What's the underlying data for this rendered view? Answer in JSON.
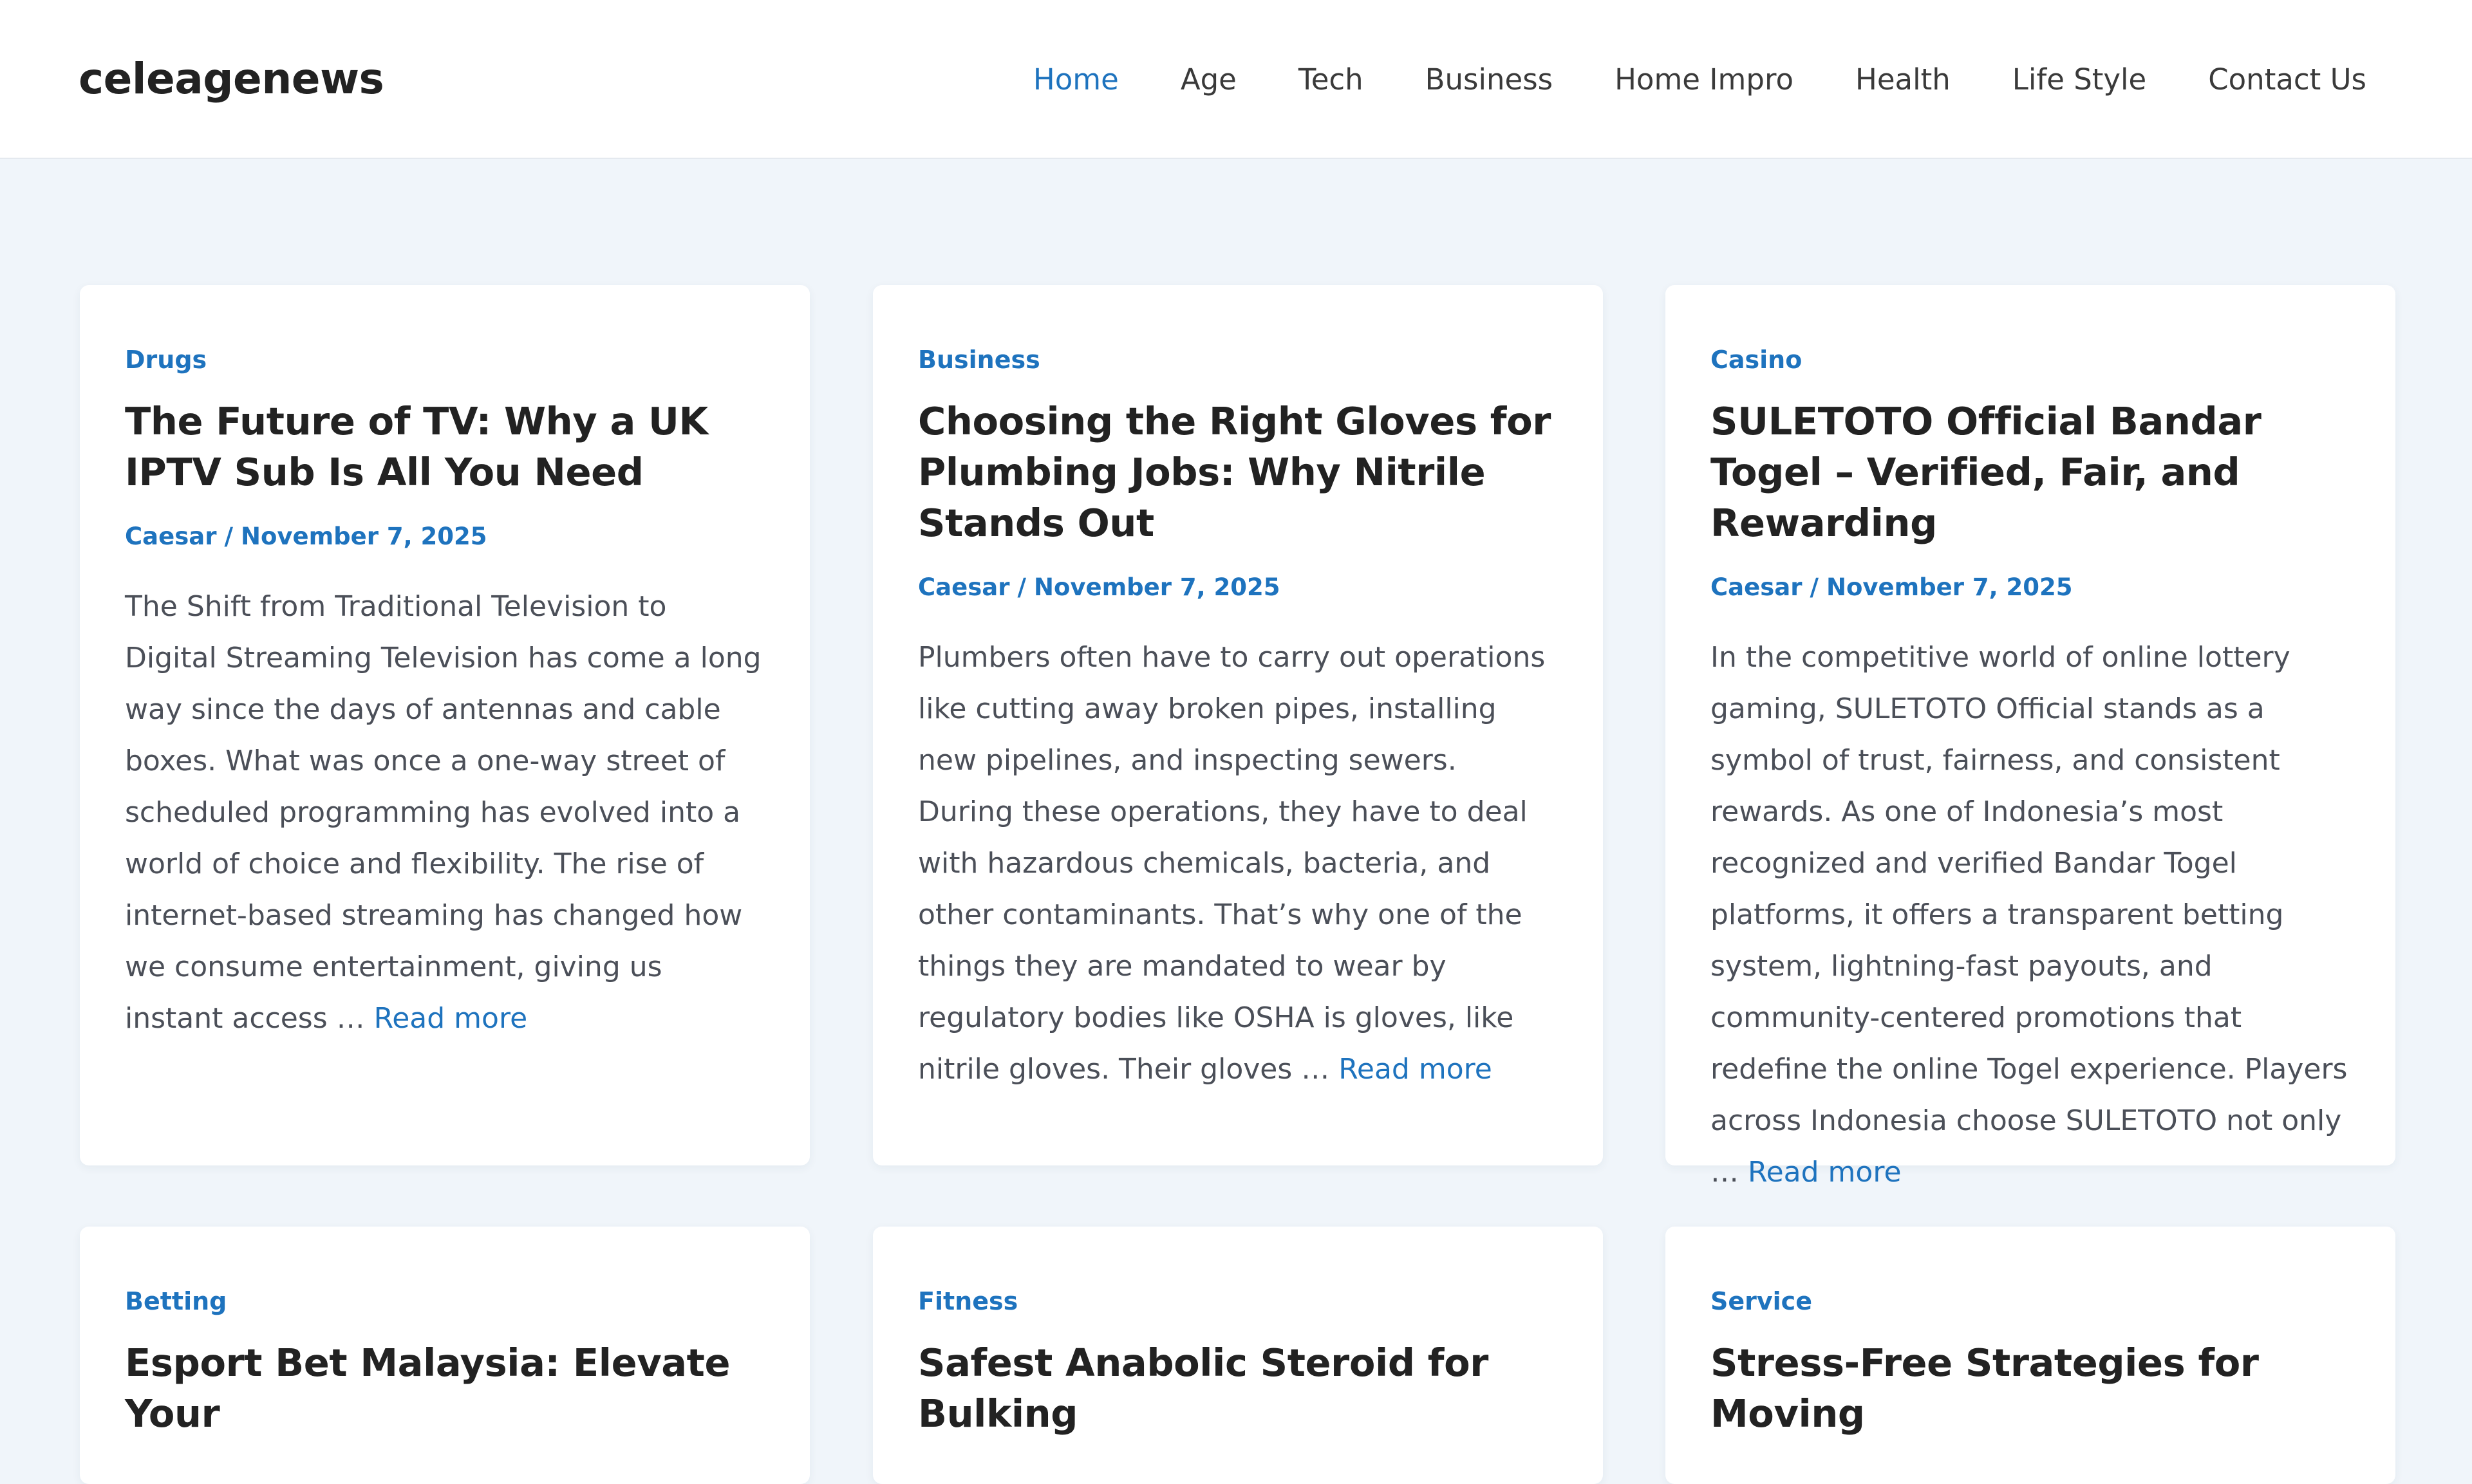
{
  "site": {
    "title": "celeagenews"
  },
  "nav": {
    "items": [
      {
        "label": "Home"
      },
      {
        "label": "Age"
      },
      {
        "label": "Tech"
      },
      {
        "label": "Business"
      },
      {
        "label": "Home Impro"
      },
      {
        "label": "Health"
      },
      {
        "label": "Life Style"
      },
      {
        "label": "Contact Us"
      }
    ],
    "active": "Home"
  },
  "colors": {
    "accent": "#1e73be",
    "background": "#f0f5fa",
    "card": "#ffffff"
  },
  "posts": [
    {
      "category": "Drugs",
      "title": "The Future of TV: Why a UK IPTV Sub Is All You Need",
      "author": "Caesar",
      "date": "November 7, 2025",
      "excerpt": "The Shift from Traditional Television to Digital Streaming Television has come a long way since the days of antennas and cable boxes. What was once a one-way street of scheduled programming has evolved into a world of choice and flexibility. The rise of internet-based streaming has changed how we consume entertainment, giving us instant access …",
      "read_more": "Read more"
    },
    {
      "category": "Business",
      "title": "Choosing the Right Gloves for Plumbing Jobs: Why Nitrile Stands Out",
      "author": "Caesar",
      "date": "November 7, 2025",
      "excerpt": "Plumbers often have to carry out operations like cutting away broken pipes, installing new pipelines, and inspecting sewers. During these operations, they have to deal with hazardous chemicals, bacteria, and other contaminants. That’s why one of the things they are mandated to wear by regulatory bodies like OSHA is gloves, like nitrile gloves. Their gloves …",
      "read_more": "Read more"
    },
    {
      "category": "Casino",
      "title": "SULETOTO Official Bandar Togel – Verified, Fair, and Rewarding",
      "author": "Caesar",
      "date": "November 7, 2025",
      "excerpt": "In the competitive world of online lottery gaming, SULETOTO Official stands as a symbol of trust, fairness, and consistent rewards. As one of Indonesia’s most recognized and verified Bandar Togel platforms, it offers a transparent betting system, lightning-fast payouts, and community-centered promotions that redefine the online Togel experience. Players across Indonesia choose SULETOTO not only …",
      "read_more": "Read more"
    },
    {
      "category": "Betting",
      "title": "Esport Bet Malaysia: Elevate Your"
    },
    {
      "category": "Fitness",
      "title": "Safest Anabolic Steroid for Bulking"
    },
    {
      "category": "Service",
      "title": "Stress-Free Strategies for Moving"
    }
  ],
  "meta_separator": "/"
}
